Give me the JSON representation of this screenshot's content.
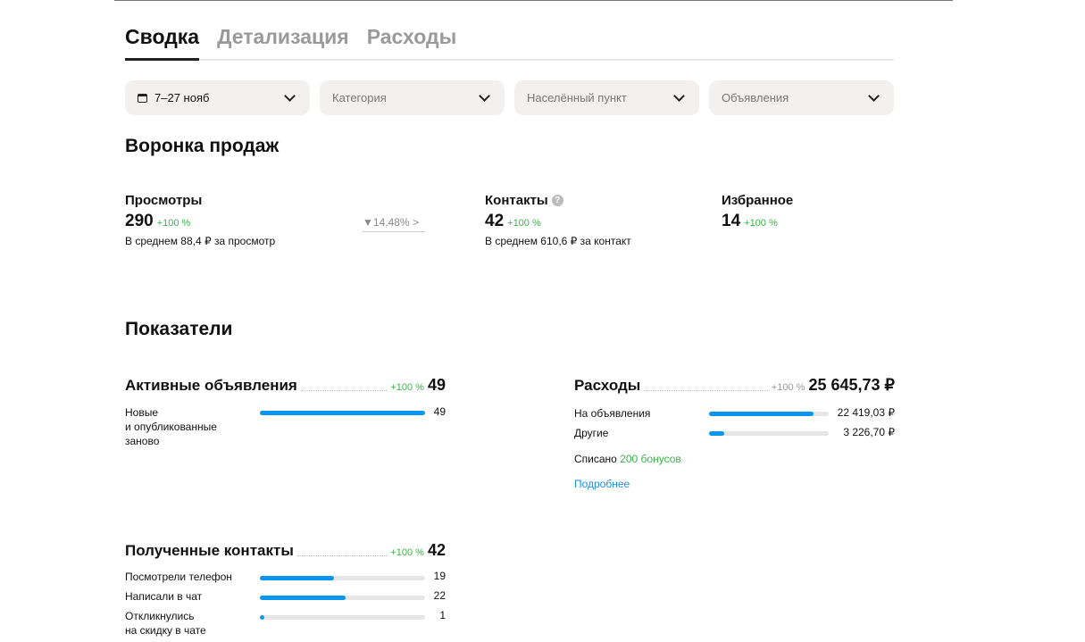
{
  "tabs": [
    "Сводка",
    "Детализация",
    "Расходы"
  ],
  "filters": {
    "date": "7–27 нояб",
    "category": "Категория",
    "city": "Населённый пункт",
    "ads": "Объявления"
  },
  "funnel": {
    "title": "Воронка продаж",
    "views": {
      "label": "Просмотры",
      "value": "290",
      "pct": "+100 %",
      "sub": "В среднем 88,4 ₽ за просмотр"
    },
    "conversion": "14,48%",
    "contacts": {
      "label": "Контакты",
      "value": "42",
      "pct": "+100 %",
      "sub": "В среднем 610,6 ₽ за контакт",
      "help": "?"
    },
    "favorites": {
      "label": "Избранное",
      "value": "14",
      "pct": "+100 %"
    }
  },
  "indicators": {
    "title": "Показатели",
    "active": {
      "label": "Активные объявления",
      "pct": "+100 %",
      "value": "49",
      "rows": [
        {
          "label": "Новые\nи опубликованные\nзаново",
          "value": "49",
          "fraction": 1.0
        }
      ]
    },
    "expenses": {
      "label": "Расходы",
      "pct": "+100 %",
      "value": "25 645,73 ₽",
      "rows": [
        {
          "label": "На объявления",
          "value": "22 419,03 ₽",
          "fraction": 0.874
        },
        {
          "label": "Другие",
          "value": "3 226,70 ₽",
          "fraction": 0.126
        }
      ],
      "bonus_prefix": "Списано",
      "bonus": "200 бонусов",
      "more": "Подробнее"
    },
    "contacts": {
      "label": "Полученные контакты",
      "pct": "+100 %",
      "value": "42",
      "rows": [
        {
          "label": "Посмотрели телефон",
          "value": "19",
          "fraction": 0.45
        },
        {
          "label": "Написали в чат",
          "value": "22",
          "fraction": 0.52
        },
        {
          "label": "Откликнулись\nна скидку в чате",
          "value": "1",
          "fraction": 0.024
        }
      ]
    }
  }
}
